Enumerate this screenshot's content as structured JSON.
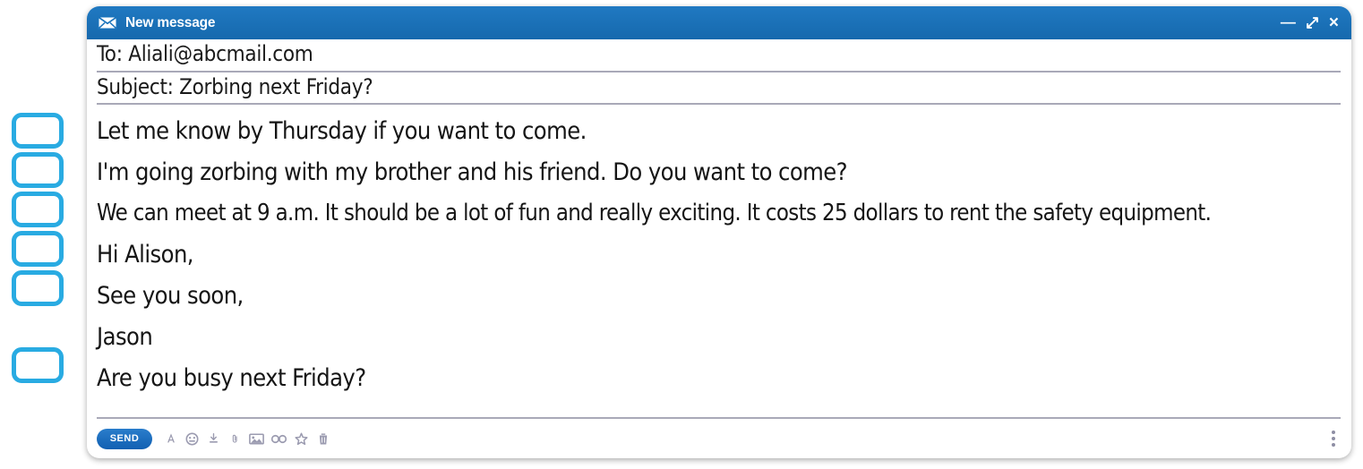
{
  "window": {
    "title": "New message",
    "envelope_icon": "envelope-icon",
    "controls": {
      "minimize": "—",
      "maximize": "maximize-icon",
      "close": "×"
    }
  },
  "fields": [
    {
      "name": "to",
      "text": "To: Aliali@abcmail.com"
    },
    {
      "name": "subject",
      "text": "Subject: Zorbing next Friday?"
    }
  ],
  "body": {
    "lines": [
      "Let me know by Thursday if you want to come.",
      "I'm going zorbing with my brother and his friend. Do you want to come?",
      "We can meet at 9 a.m. It should be a lot of fun and really exciting. It costs 25 dollars to rent the safety equipment.",
      "Hi Alison,",
      "See you soon,",
      "Jason",
      "Are you busy next Friday?"
    ]
  },
  "toolbar": {
    "send_label": "SEND",
    "icons": [
      "format-text-icon",
      "emoji-icon",
      "attach-download-icon",
      "paperclip-icon",
      "insert-image-icon",
      "insert-link-icon",
      "star-icon",
      "delete-icon"
    ],
    "more_options": "more-options-icon"
  },
  "checkboxes": [
    {
      "name": "checkbox-1",
      "checked": false
    },
    {
      "name": "checkbox-2",
      "checked": false
    },
    {
      "name": "checkbox-3",
      "checked": false
    },
    {
      "name": "checkbox-4",
      "checked": false
    },
    {
      "name": "checkbox-5",
      "checked": false
    },
    {
      "name": "checkbox-6",
      "checked": false
    }
  ],
  "colors": {
    "title_bar": "#1B74BC",
    "checkbox_border": "#29ABE2",
    "send_button": "#1565b8",
    "separator": "#a9a9b8",
    "icon_gray": "#9b9bb0"
  }
}
